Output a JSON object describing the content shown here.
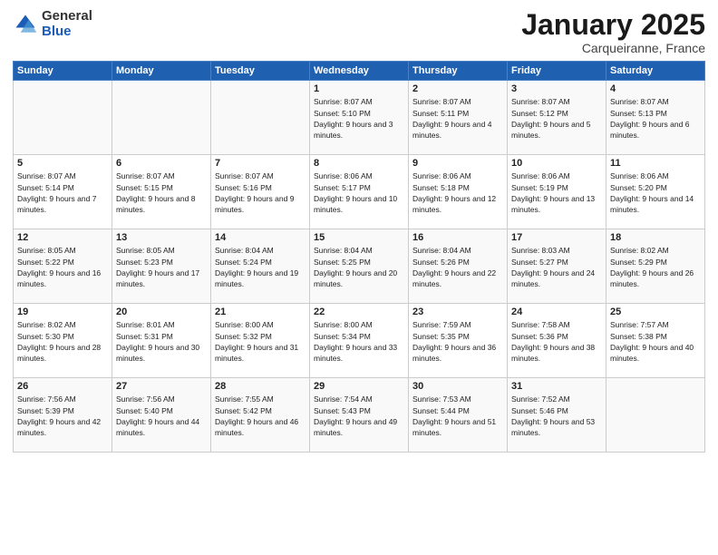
{
  "header": {
    "logo_general": "General",
    "logo_blue": "Blue",
    "title": "January 2025",
    "subtitle": "Carqueiranne, France"
  },
  "weekdays": [
    "Sunday",
    "Monday",
    "Tuesday",
    "Wednesday",
    "Thursday",
    "Friday",
    "Saturday"
  ],
  "weeks": [
    [
      {
        "day": "",
        "info": ""
      },
      {
        "day": "",
        "info": ""
      },
      {
        "day": "",
        "info": ""
      },
      {
        "day": "1",
        "info": "Sunrise: 8:07 AM\nSunset: 5:10 PM\nDaylight: 9 hours and 3 minutes."
      },
      {
        "day": "2",
        "info": "Sunrise: 8:07 AM\nSunset: 5:11 PM\nDaylight: 9 hours and 4 minutes."
      },
      {
        "day": "3",
        "info": "Sunrise: 8:07 AM\nSunset: 5:12 PM\nDaylight: 9 hours and 5 minutes."
      },
      {
        "day": "4",
        "info": "Sunrise: 8:07 AM\nSunset: 5:13 PM\nDaylight: 9 hours and 6 minutes."
      }
    ],
    [
      {
        "day": "5",
        "info": "Sunrise: 8:07 AM\nSunset: 5:14 PM\nDaylight: 9 hours and 7 minutes."
      },
      {
        "day": "6",
        "info": "Sunrise: 8:07 AM\nSunset: 5:15 PM\nDaylight: 9 hours and 8 minutes."
      },
      {
        "day": "7",
        "info": "Sunrise: 8:07 AM\nSunset: 5:16 PM\nDaylight: 9 hours and 9 minutes."
      },
      {
        "day": "8",
        "info": "Sunrise: 8:06 AM\nSunset: 5:17 PM\nDaylight: 9 hours and 10 minutes."
      },
      {
        "day": "9",
        "info": "Sunrise: 8:06 AM\nSunset: 5:18 PM\nDaylight: 9 hours and 12 minutes."
      },
      {
        "day": "10",
        "info": "Sunrise: 8:06 AM\nSunset: 5:19 PM\nDaylight: 9 hours and 13 minutes."
      },
      {
        "day": "11",
        "info": "Sunrise: 8:06 AM\nSunset: 5:20 PM\nDaylight: 9 hours and 14 minutes."
      }
    ],
    [
      {
        "day": "12",
        "info": "Sunrise: 8:05 AM\nSunset: 5:22 PM\nDaylight: 9 hours and 16 minutes."
      },
      {
        "day": "13",
        "info": "Sunrise: 8:05 AM\nSunset: 5:23 PM\nDaylight: 9 hours and 17 minutes."
      },
      {
        "day": "14",
        "info": "Sunrise: 8:04 AM\nSunset: 5:24 PM\nDaylight: 9 hours and 19 minutes."
      },
      {
        "day": "15",
        "info": "Sunrise: 8:04 AM\nSunset: 5:25 PM\nDaylight: 9 hours and 20 minutes."
      },
      {
        "day": "16",
        "info": "Sunrise: 8:04 AM\nSunset: 5:26 PM\nDaylight: 9 hours and 22 minutes."
      },
      {
        "day": "17",
        "info": "Sunrise: 8:03 AM\nSunset: 5:27 PM\nDaylight: 9 hours and 24 minutes."
      },
      {
        "day": "18",
        "info": "Sunrise: 8:02 AM\nSunset: 5:29 PM\nDaylight: 9 hours and 26 minutes."
      }
    ],
    [
      {
        "day": "19",
        "info": "Sunrise: 8:02 AM\nSunset: 5:30 PM\nDaylight: 9 hours and 28 minutes."
      },
      {
        "day": "20",
        "info": "Sunrise: 8:01 AM\nSunset: 5:31 PM\nDaylight: 9 hours and 30 minutes."
      },
      {
        "day": "21",
        "info": "Sunrise: 8:00 AM\nSunset: 5:32 PM\nDaylight: 9 hours and 31 minutes."
      },
      {
        "day": "22",
        "info": "Sunrise: 8:00 AM\nSunset: 5:34 PM\nDaylight: 9 hours and 33 minutes."
      },
      {
        "day": "23",
        "info": "Sunrise: 7:59 AM\nSunset: 5:35 PM\nDaylight: 9 hours and 36 minutes."
      },
      {
        "day": "24",
        "info": "Sunrise: 7:58 AM\nSunset: 5:36 PM\nDaylight: 9 hours and 38 minutes."
      },
      {
        "day": "25",
        "info": "Sunrise: 7:57 AM\nSunset: 5:38 PM\nDaylight: 9 hours and 40 minutes."
      }
    ],
    [
      {
        "day": "26",
        "info": "Sunrise: 7:56 AM\nSunset: 5:39 PM\nDaylight: 9 hours and 42 minutes."
      },
      {
        "day": "27",
        "info": "Sunrise: 7:56 AM\nSunset: 5:40 PM\nDaylight: 9 hours and 44 minutes."
      },
      {
        "day": "28",
        "info": "Sunrise: 7:55 AM\nSunset: 5:42 PM\nDaylight: 9 hours and 46 minutes."
      },
      {
        "day": "29",
        "info": "Sunrise: 7:54 AM\nSunset: 5:43 PM\nDaylight: 9 hours and 49 minutes."
      },
      {
        "day": "30",
        "info": "Sunrise: 7:53 AM\nSunset: 5:44 PM\nDaylight: 9 hours and 51 minutes."
      },
      {
        "day": "31",
        "info": "Sunrise: 7:52 AM\nSunset: 5:46 PM\nDaylight: 9 hours and 53 minutes."
      },
      {
        "day": "",
        "info": ""
      }
    ]
  ]
}
